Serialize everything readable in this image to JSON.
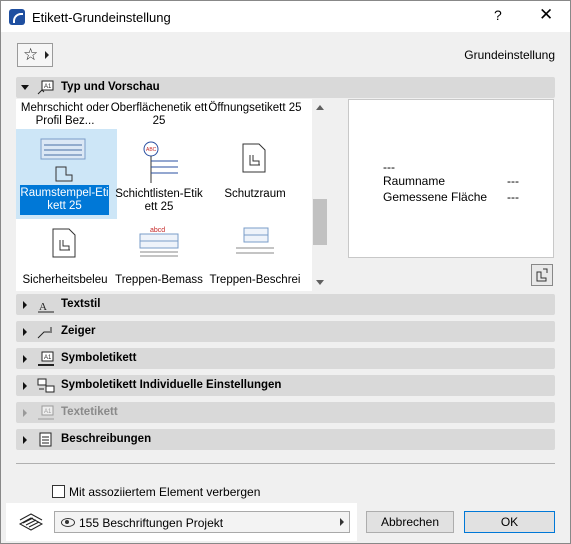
{
  "window": {
    "title": "Etikett-Grundeinstellung",
    "help": "?",
    "close": "✕"
  },
  "toolbar": {
    "favorites_icon": "star-icon",
    "preset_name": "Grundeinstellung"
  },
  "sections": {
    "type_preview": "Typ und Vorschau",
    "text_style": "Textstil",
    "pointer": "Zeiger",
    "symbol_label": "Symboletikett",
    "symbol_label_custom": "Symboletikett Individuelle Einstellungen",
    "text_label": "Textetikett",
    "descriptions": "Beschreibungen"
  },
  "gallery": {
    "items": [
      {
        "label": "Mehrschicht oder Profil Bez..."
      },
      {
        "label": "Oberflächenetik ett 25"
      },
      {
        "label": "Öffnungsetikett 25"
      },
      {
        "label": "Raumstempel-Eti kett 25"
      },
      {
        "label": "Schichtlisten-Etik ett 25"
      },
      {
        "label": "Schutzraum"
      },
      {
        "label": "Sicherheitsbeleu"
      },
      {
        "label": "Treppen-Bemass"
      },
      {
        "label": "Treppen-Beschrei"
      }
    ]
  },
  "preview": {
    "line1": "---",
    "room_name": "Raumname",
    "room_name_value": "---",
    "area": "Gemessene Fläche",
    "area_value": "---"
  },
  "hide_checkbox": {
    "label": "Mit assoziiertem Element verbergen",
    "checked": false
  },
  "footer": {
    "layer": "155 Beschriftungen Projekt",
    "cancel": "Abbrechen",
    "ok": "OK"
  },
  "colors": {
    "selection": "#0078d7",
    "section_bg": "#d9d9d9"
  }
}
